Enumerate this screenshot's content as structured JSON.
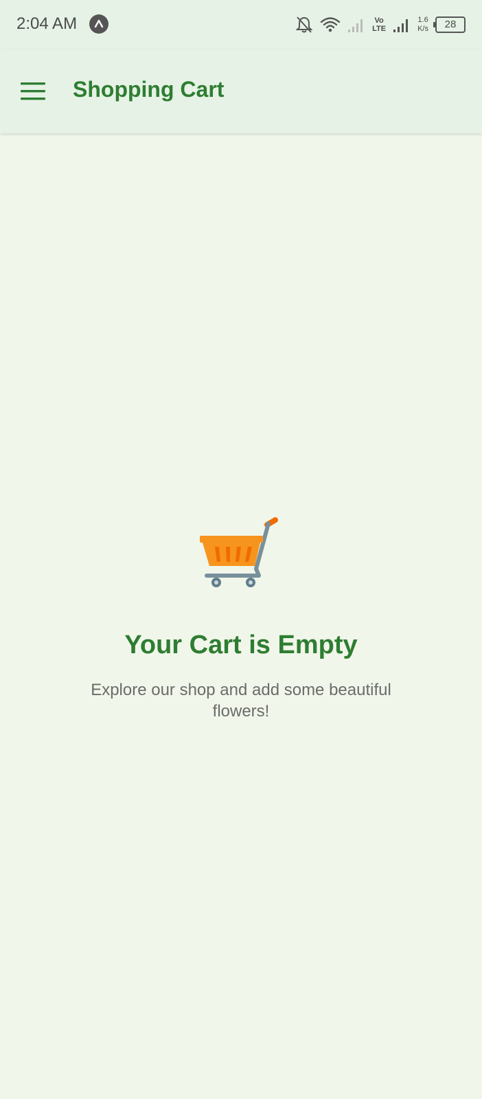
{
  "status_bar": {
    "time": "2:04 AM",
    "volte_top": "Vo",
    "volte_bottom": "LTE",
    "net_speed_value": "1.6",
    "net_speed_unit": "K/s",
    "battery": "28"
  },
  "app_bar": {
    "title": "Shopping Cart",
    "menu_icon": "hamburger-menu-icon"
  },
  "empty_state": {
    "icon": "shopping-cart-icon",
    "title": "Your Cart is Empty",
    "message": "Explore our shop and add some beautiful flowers!"
  },
  "colors": {
    "primary": "#2e7d32",
    "app_bar_bg": "#e6f2e5",
    "page_bg": "#f1f6ea",
    "cart_basket": "#f7941d",
    "cart_frame": "#78909c"
  }
}
